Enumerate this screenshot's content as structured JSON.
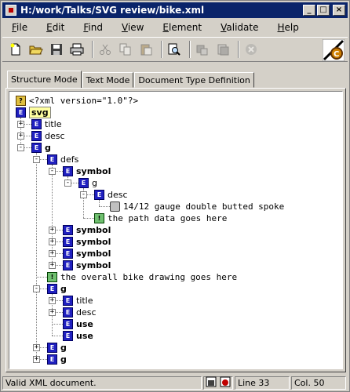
{
  "window": {
    "title": "H:/work/Talks/SVG review/bike.xml"
  },
  "menu": [
    {
      "label": "File",
      "name": "menu-file"
    },
    {
      "label": "Edit",
      "name": "menu-edit"
    },
    {
      "label": "Find",
      "name": "menu-find"
    },
    {
      "label": "View",
      "name": "menu-view"
    },
    {
      "label": "Element",
      "name": "menu-element"
    },
    {
      "label": "Validate",
      "name": "menu-validate"
    },
    {
      "label": "Help",
      "name": "menu-help"
    }
  ],
  "toolbar": {
    "icons": [
      "new-document-icon",
      "open-folder-icon",
      "save-icon",
      "print-icon",
      "cut-icon",
      "copy-icon",
      "paste-icon",
      "find-icon",
      "copy-node-icon",
      "paste-node-icon",
      "stop-icon"
    ]
  },
  "tabs": [
    {
      "label": "Structure Mode",
      "active": true
    },
    {
      "label": "Text Mode",
      "active": false
    },
    {
      "label": "Document Type Definition",
      "active": false
    }
  ],
  "tree": [
    {
      "depth": 0,
      "kind": "pi",
      "text": "<?xml version=\"1.0\"?>",
      "exp": ""
    },
    {
      "depth": 0,
      "kind": "elem",
      "text": "svg",
      "exp": "",
      "selected": true
    },
    {
      "depth": 1,
      "kind": "elem",
      "text": "title",
      "exp": "+"
    },
    {
      "depth": 1,
      "kind": "elem",
      "text": "desc",
      "exp": "+"
    },
    {
      "depth": 1,
      "kind": "elem",
      "text": "g",
      "exp": "-",
      "bold": true
    },
    {
      "depth": 2,
      "kind": "elem",
      "text": "defs",
      "exp": "-"
    },
    {
      "depth": 3,
      "kind": "elem",
      "text": "symbol",
      "exp": "-",
      "bold": true
    },
    {
      "depth": 4,
      "kind": "elem",
      "text": "g",
      "exp": "-"
    },
    {
      "depth": 5,
      "kind": "elem",
      "text": "desc",
      "exp": "-"
    },
    {
      "depth": 6,
      "kind": "text",
      "text": "14/12 gauge double butted spoke",
      "exp": ""
    },
    {
      "depth": 5,
      "kind": "comment",
      "text": "the path data goes here",
      "exp": ""
    },
    {
      "depth": 3,
      "kind": "elem",
      "text": "symbol",
      "exp": "+",
      "bold": true
    },
    {
      "depth": 3,
      "kind": "elem",
      "text": "symbol",
      "exp": "+",
      "bold": true
    },
    {
      "depth": 3,
      "kind": "elem",
      "text": "symbol",
      "exp": "+",
      "bold": true
    },
    {
      "depth": 3,
      "kind": "elem",
      "text": "symbol",
      "exp": "+",
      "bold": true
    },
    {
      "depth": 2,
      "kind": "comment",
      "text": "the overall bike drawing goes here",
      "exp": ""
    },
    {
      "depth": 2,
      "kind": "elem",
      "text": "g",
      "exp": "-",
      "bold": true
    },
    {
      "depth": 3,
      "kind": "elem",
      "text": "title",
      "exp": "+"
    },
    {
      "depth": 3,
      "kind": "elem",
      "text": "desc",
      "exp": "+"
    },
    {
      "depth": 3,
      "kind": "elem",
      "text": "use",
      "exp": "",
      "bold": true
    },
    {
      "depth": 3,
      "kind": "elem",
      "text": "use",
      "exp": "",
      "bold": true
    },
    {
      "depth": 2,
      "kind": "elem",
      "text": "g",
      "exp": "+",
      "bold": true
    },
    {
      "depth": 2,
      "kind": "elem",
      "text": "g",
      "exp": "+",
      "bold": true
    }
  ],
  "status": {
    "message": "Valid XML document.",
    "line": "Line 33",
    "col": "Col. 50"
  },
  "colors": {
    "titlebar": "#0a246a",
    "element_icon": "#2020c0",
    "selection": "#ffffa0"
  }
}
